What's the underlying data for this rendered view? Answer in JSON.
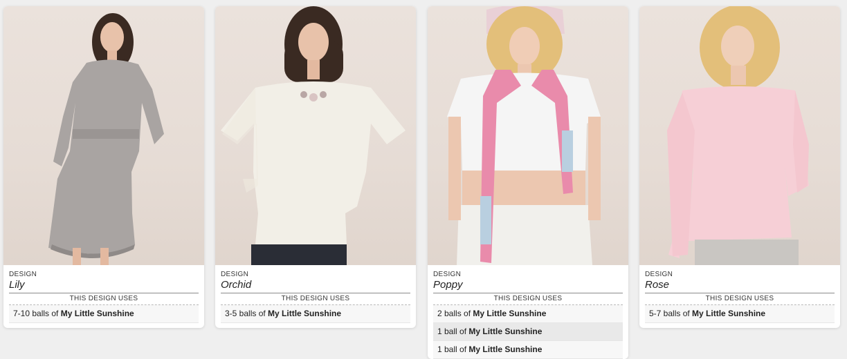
{
  "cards": [
    {
      "label": "DESIGN",
      "name": "Lily",
      "uses_header": "THIS DESIGN USES",
      "yarns": [
        {
          "qty": "7-10 balls of",
          "yarn": "My Little Sunshine"
        }
      ],
      "garment_color": "#a9a4a2"
    },
    {
      "label": "DESIGN",
      "name": "Orchid",
      "uses_header": "THIS DESIGN USES",
      "yarns": [
        {
          "qty": "3-5 balls of",
          "yarn": "My Little Sunshine"
        }
      ],
      "garment_color": "#f2efe7"
    },
    {
      "label": "DESIGN",
      "name": "Poppy",
      "uses_header": "THIS DESIGN USES",
      "yarns": [
        {
          "qty": "2 balls of",
          "yarn": "My Little Sunshine"
        },
        {
          "qty": "1 ball of",
          "yarn": "My Little Sunshine"
        },
        {
          "qty": "1 ball of",
          "yarn": "My Little Sunshine"
        }
      ],
      "garment_color": "#e98bab"
    },
    {
      "label": "DESIGN",
      "name": "Rose",
      "uses_header": "THIS DESIGN USES",
      "yarns": [
        {
          "qty": "5-7 balls of",
          "yarn": "My Little Sunshine"
        }
      ],
      "garment_color": "#f6cfd6"
    }
  ]
}
